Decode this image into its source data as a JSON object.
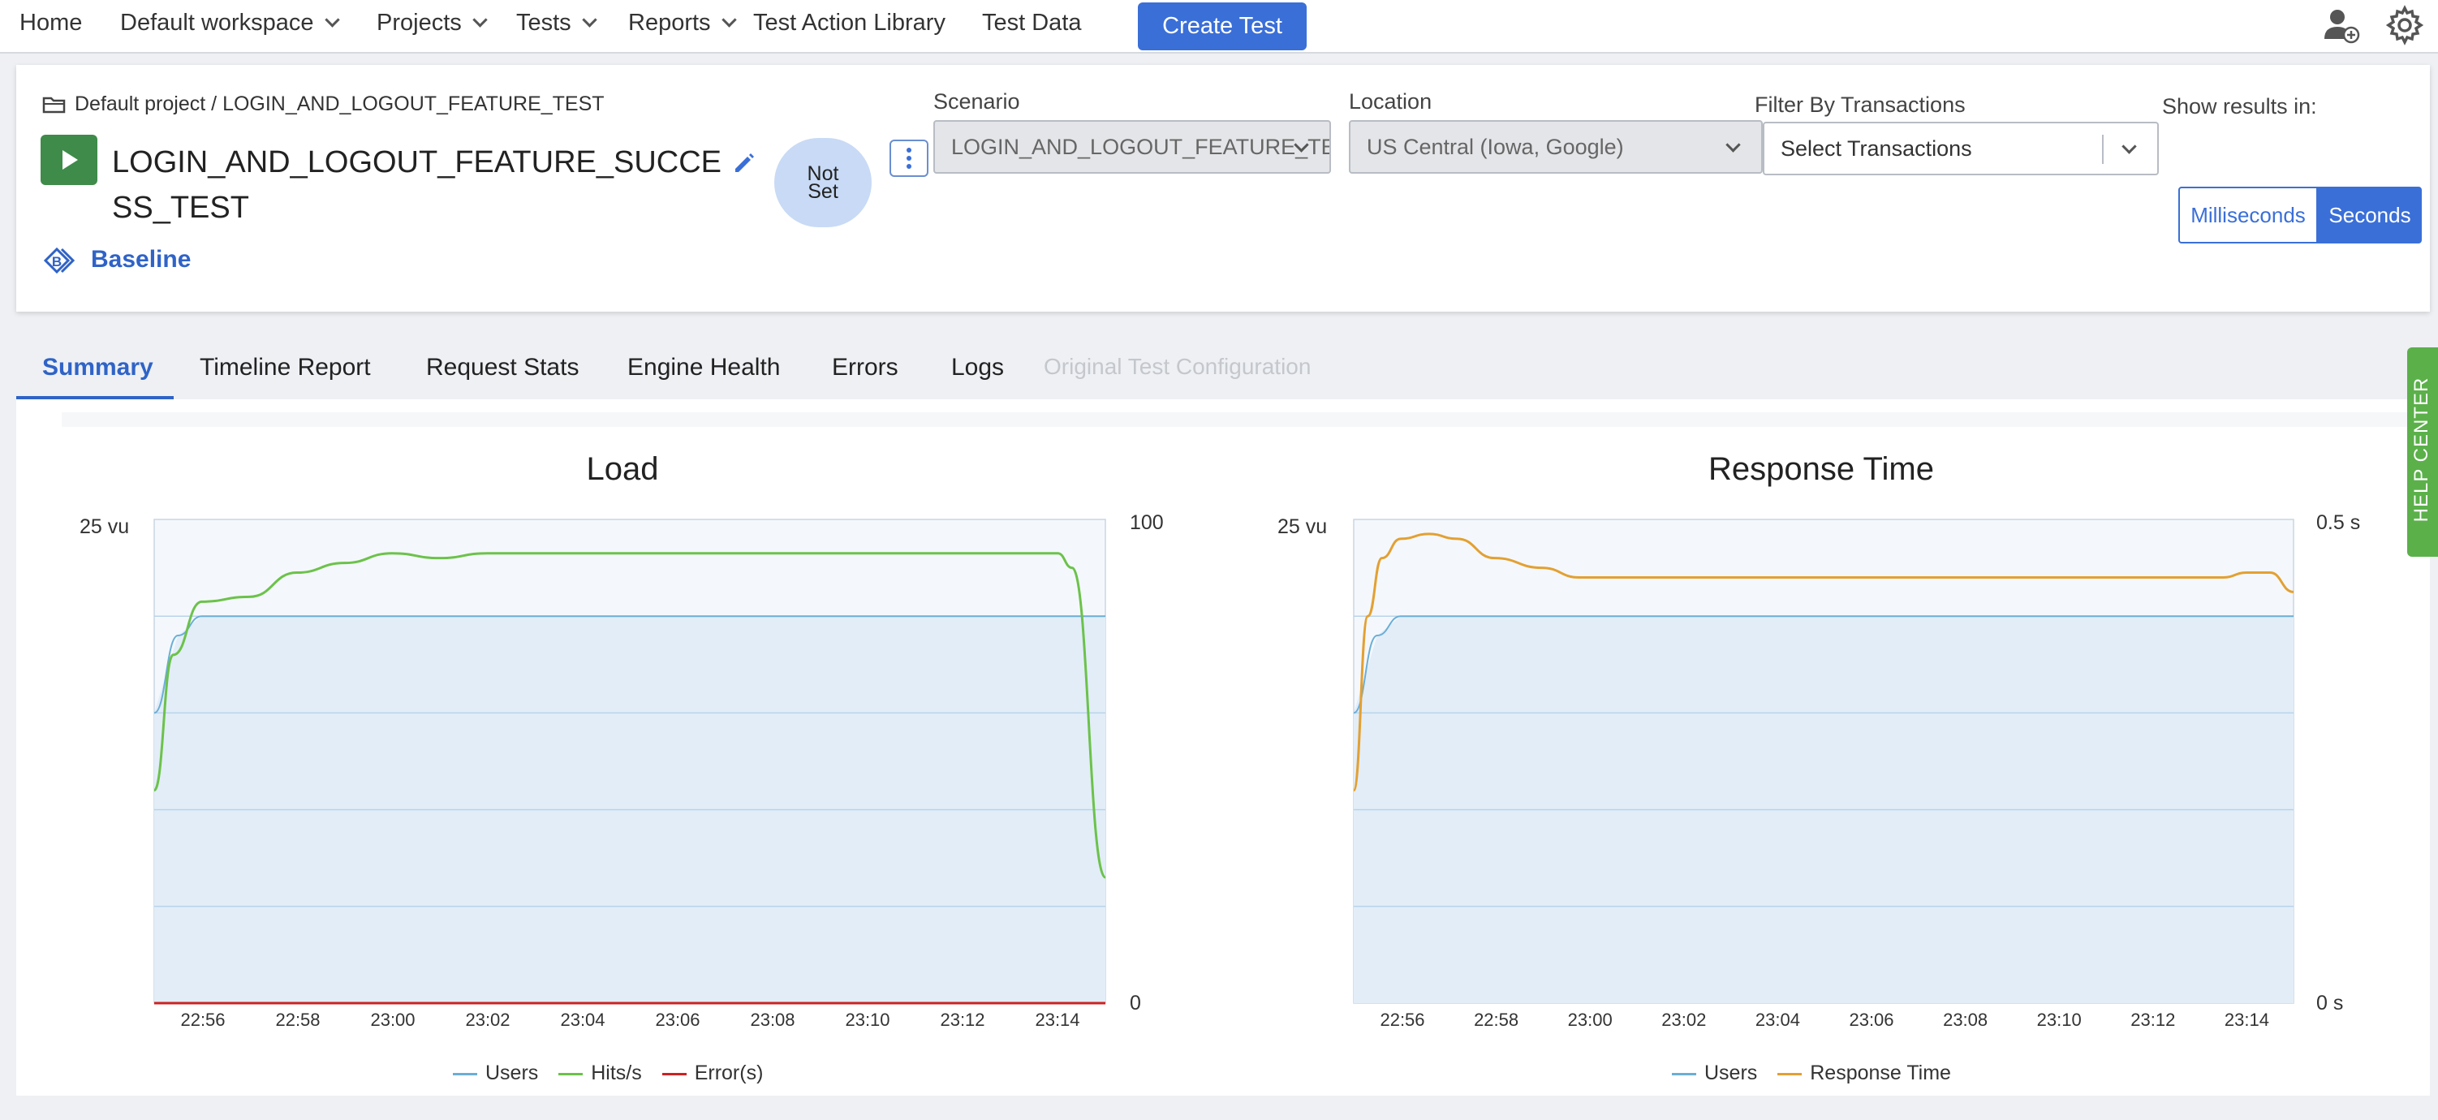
{
  "nav": {
    "home": "Home",
    "workspace": "Default workspace",
    "projects": "Projects",
    "tests": "Tests",
    "reports": "Reports",
    "action_library": "Test Action Library",
    "test_data": "Test Data",
    "create_test": "Create Test"
  },
  "header": {
    "breadcrumb_project": "Default project",
    "breadcrumb_sep": "/",
    "breadcrumb_test": "LOGIN_AND_LOGOUT_FEATURE_TEST",
    "test_name": "LOGIN_AND_LOGOUT_FEATURE_SUCCESS_TEST",
    "status_line1": "Not",
    "status_line2": "Set",
    "baseline_label": "Baseline",
    "scenario_label": "Scenario",
    "scenario_value": "LOGIN_AND_LOGOUT_FEATURE_TEST",
    "location_label": "Location",
    "location_value": "US Central (Iowa, Google)",
    "filter_label": "Filter By Transactions",
    "filter_placeholder": "Select Transactions",
    "units_label": "Show results in:",
    "unit_ms": "Milliseconds",
    "unit_s": "Seconds",
    "selected_unit": "Seconds"
  },
  "tabs": [
    "Summary",
    "Timeline Report",
    "Request Stats",
    "Engine Health",
    "Errors",
    "Logs",
    "Original Test Configuration"
  ],
  "help_center": "HELP CENTER",
  "chart_data": [
    {
      "type": "line",
      "title": "Load",
      "left_axis_label": "25 vu",
      "right_axis_top": "100",
      "right_axis_bottom": "0",
      "x_ticks": [
        "22:56",
        "22:58",
        "23:00",
        "23:02",
        "23:04",
        "23:06",
        "23:08",
        "23:10",
        "23:12",
        "23:14"
      ],
      "legend": [
        "Users",
        "Hits/s",
        "Error(s)"
      ],
      "colors": {
        "Users": "#6baed6",
        "Hits/s": "#6cc24a",
        "Error(s)": "#cc2222"
      },
      "series": [
        {
          "name": "Users",
          "axis": "left",
          "x": [
            0,
            0.5,
            1,
            20
          ],
          "y": [
            15,
            19,
            20,
            20
          ]
        },
        {
          "name": "Hits/s",
          "axis": "right",
          "x": [
            0,
            0.4,
            1,
            2,
            3,
            4,
            5,
            6,
            7,
            8,
            9,
            10,
            11,
            12,
            13,
            14,
            15,
            16,
            17,
            18,
            19,
            19.3,
            20
          ],
          "y": [
            44,
            72,
            83,
            84,
            89,
            91,
            93,
            92,
            93,
            93,
            93,
            93,
            93,
            93,
            93,
            93,
            93,
            93,
            93,
            93,
            93,
            90,
            26
          ]
        },
        {
          "name": "Error(s)",
          "axis": "right",
          "x": [
            0,
            20
          ],
          "y": [
            0,
            0
          ]
        }
      ]
    },
    {
      "type": "line",
      "title": "Response Time",
      "left_axis_label": "25 vu",
      "right_axis_top": "0.5 s",
      "right_axis_bottom": "0 s",
      "x_ticks": [
        "22:56",
        "22:58",
        "23:00",
        "23:02",
        "23:04",
        "23:06",
        "23:08",
        "23:10",
        "23:12",
        "23:14"
      ],
      "legend": [
        "Users",
        "Response Time"
      ],
      "colors": {
        "Users": "#6baed6",
        "Response Time": "#e3a032"
      },
      "series": [
        {
          "name": "Users",
          "axis": "left",
          "x": [
            0,
            0.5,
            1,
            20
          ],
          "y": [
            15,
            19,
            20,
            20
          ]
        },
        {
          "name": "Response Time",
          "axis": "right",
          "x": [
            0,
            0.3,
            0.6,
            1,
            1.6,
            2.2,
            3,
            4,
            4.8,
            6,
            8,
            10,
            12,
            14,
            16,
            17,
            18,
            18.5,
            19,
            19.5,
            20
          ],
          "y": [
            0.22,
            0.4,
            0.46,
            0.48,
            0.485,
            0.48,
            0.46,
            0.45,
            0.44,
            0.44,
            0.44,
            0.44,
            0.44,
            0.44,
            0.44,
            0.44,
            0.44,
            0.44,
            0.445,
            0.445,
            0.425
          ]
        }
      ]
    }
  ]
}
